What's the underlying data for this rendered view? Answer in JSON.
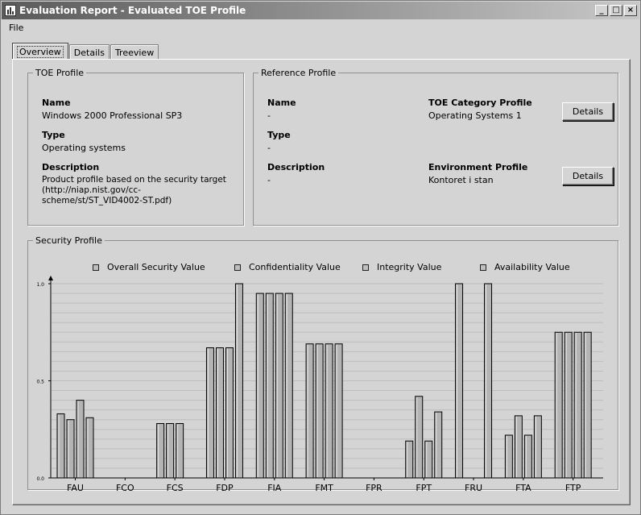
{
  "window": {
    "title": "Evaluation Report - Evaluated TOE Profile"
  },
  "menu": {
    "file": "File"
  },
  "tabs": [
    {
      "label": "Overview",
      "active": true
    },
    {
      "label": "Details",
      "active": false
    },
    {
      "label": "Treeview",
      "active": false
    }
  ],
  "toe_profile": {
    "legend": "TOE Profile",
    "name_label": "Name",
    "name_value": "Windows 2000 Professional SP3",
    "type_label": "Type",
    "type_value": "Operating systems",
    "description_label": "Description",
    "description_lines": [
      "Product profile based on the security target",
      "(http://niap.nist.gov/cc-",
      "scheme/st/ST_VID4002-ST.pdf)"
    ]
  },
  "reference_profile": {
    "legend": "Reference Profile",
    "name_label": "Name",
    "name_value": "-",
    "type_label": "Type",
    "type_value": "-",
    "description_label": "Description",
    "description_value": "-",
    "toe_category_label": "TOE Category Profile",
    "toe_category_value": "Operating Systems 1",
    "environment_label": "Environment Profile",
    "environment_value": "Kontoret i stan",
    "details_button_1": "Details",
    "details_button_2": "Details"
  },
  "security_profile": {
    "legend": "Security Profile"
  },
  "chart_data": {
    "type": "bar",
    "categories": [
      "FAU",
      "FCO",
      "FCS",
      "FDP",
      "FIA",
      "FMT",
      "FPR",
      "FPT",
      "FRU",
      "FTA",
      "FTP"
    ],
    "series": [
      {
        "name": "Overall Security Value",
        "values": [
          0.33,
          0,
          0.28,
          0.67,
          0.95,
          0.69,
          0,
          0.19,
          1.0,
          0.22,
          0.75
        ]
      },
      {
        "name": "Confidentiality Value",
        "values": [
          0.3,
          0,
          0.28,
          0.67,
          0.95,
          0.69,
          0,
          0.42,
          0,
          0.32,
          0.75
        ]
      },
      {
        "name": "Integrity Value",
        "values": [
          0.4,
          0,
          0.28,
          0.67,
          0.95,
          0.69,
          0,
          0.19,
          0,
          0.22,
          0.75
        ]
      },
      {
        "name": "Availability Value",
        "values": [
          0.31,
          0,
          0,
          1.0,
          0.95,
          0.69,
          0,
          0.34,
          1.0,
          0.32,
          0.75
        ]
      }
    ],
    "yticks": [
      "0.0",
      "0.5",
      "1.0"
    ],
    "ylim": [
      0,
      1
    ],
    "grid": true,
    "legend_position": "top"
  },
  "colors": {
    "bar": "#b4b4b4",
    "grid": "#bdbdbd",
    "background": "#d4d4d4"
  }
}
